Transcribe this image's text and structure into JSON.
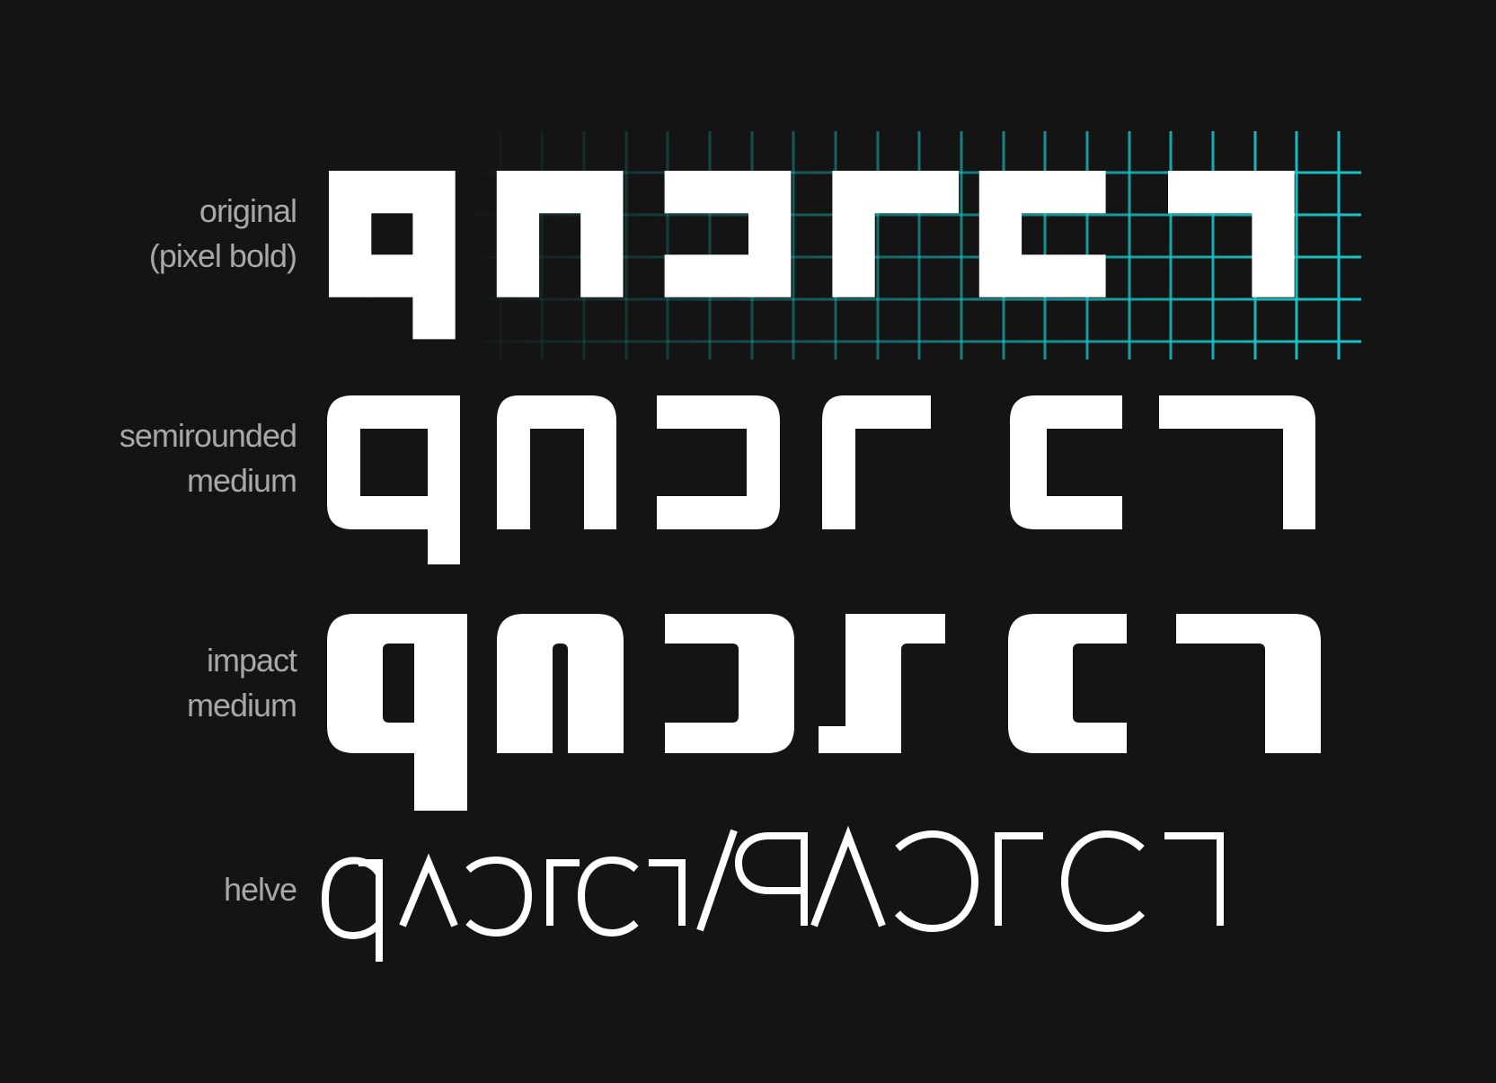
{
  "labels": {
    "original": [
      "original",
      "(pixel bold)"
    ],
    "semirounded": [
      "semirounded",
      "medium"
    ],
    "impact": [
      "impact",
      "medium"
    ],
    "helve": [
      "helve"
    ]
  },
  "helve_specimen": "qʌɔɾcɿ/PΛƆΓCΓ",
  "colors": {
    "background": "#141414",
    "glyph": "#ffffff",
    "label": "#a8a8a8",
    "grid": "#19c3c7"
  }
}
